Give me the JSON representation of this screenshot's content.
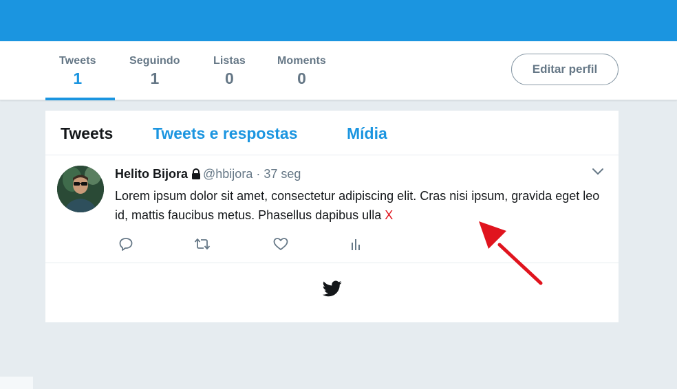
{
  "colors": {
    "accent": "#1b95e0",
    "annotation": "#e0141e"
  },
  "profile_nav": {
    "stats": [
      {
        "label": "Tweets",
        "value": "1"
      },
      {
        "label": "Seguindo",
        "value": "1"
      },
      {
        "label": "Listas",
        "value": "0"
      },
      {
        "label": "Moments",
        "value": "0"
      }
    ],
    "edit_button": "Editar perfil"
  },
  "timeline": {
    "tabs": [
      {
        "label": "Tweets"
      },
      {
        "label": "Tweets e respostas"
      },
      {
        "label": "Mídia"
      }
    ],
    "tweet": {
      "name": "Helito Bijora",
      "handle": "@hbijora",
      "separator": "·",
      "time": "37 seg",
      "text": "Lorem ipsum dolor sit amet, consectetur adipiscing elit. Cras nisi ipsum, gravida eget leo id, mattis faucibus metus. Phasellus dapibus ulla",
      "annotation_mark": "X",
      "icons": [
        "reply-icon",
        "retweet-icon",
        "like-icon",
        "analytics-icon",
        "chevron-down-icon",
        "lock-icon"
      ]
    },
    "footer_icon": "twitter-bird-icon"
  }
}
